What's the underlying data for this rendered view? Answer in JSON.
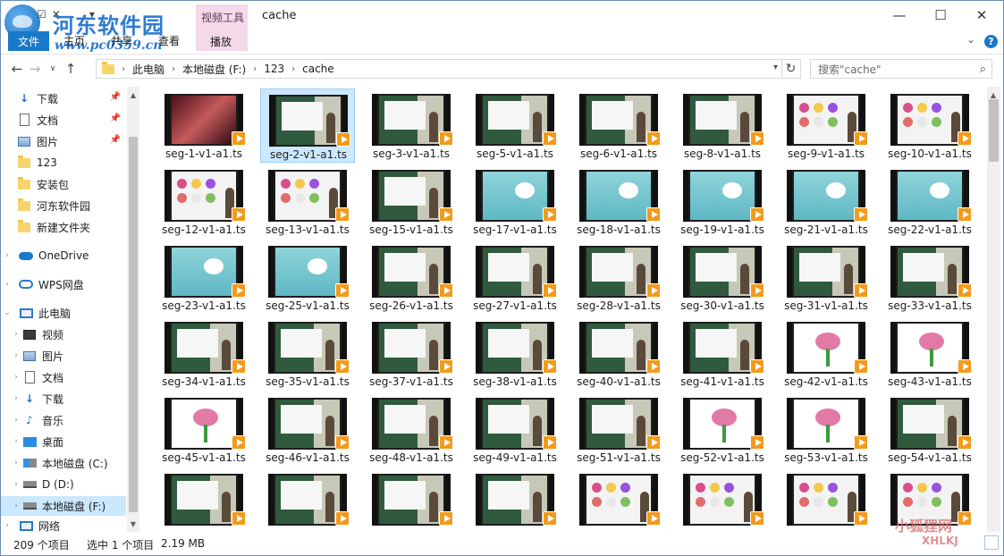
{
  "window": {
    "title": "cache",
    "brand_name": "河东软件园",
    "brand_url": "www.pc0359.cn"
  },
  "ribbon": {
    "file_tab": "文件",
    "tabs": [
      "主页",
      "共享",
      "查看"
    ],
    "context_group": "视频工具",
    "context_tab": "播放"
  },
  "address": {
    "crumbs": [
      "此电脑",
      "本地磁盘 (F:)",
      "123",
      "cache"
    ],
    "search_placeholder": "搜索\"cache\""
  },
  "sidebar": {
    "items": [
      {
        "label": "下载",
        "icon": "download-icon",
        "pinned": true
      },
      {
        "label": "文档",
        "icon": "document-icon",
        "pinned": true
      },
      {
        "label": "图片",
        "icon": "picture-icon",
        "pinned": true
      },
      {
        "label": "123",
        "icon": "folder-icon",
        "pinned": false
      },
      {
        "label": "安装包",
        "icon": "folder-icon",
        "pinned": false
      },
      {
        "label": "河东软件园",
        "icon": "folder-icon",
        "pinned": false
      },
      {
        "label": "新建文件夹",
        "icon": "folder-icon",
        "pinned": false
      },
      {
        "label": "OneDrive",
        "icon": "onedrive-icon",
        "pinned": false
      },
      {
        "label": "WPS网盘",
        "icon": "wps-cloud-icon",
        "pinned": false
      },
      {
        "label": "此电脑",
        "icon": "this-pc-icon",
        "pinned": false
      },
      {
        "label": "视频",
        "icon": "video-icon",
        "pinned": false
      },
      {
        "label": "图片",
        "icon": "picture-icon",
        "pinned": false
      },
      {
        "label": "文档",
        "icon": "document-icon",
        "pinned": false
      },
      {
        "label": "下载",
        "icon": "download-icon",
        "pinned": false
      },
      {
        "label": "音乐",
        "icon": "music-icon",
        "pinned": false
      },
      {
        "label": "桌面",
        "icon": "desktop-icon",
        "pinned": false
      },
      {
        "label": "本地磁盘 (C:)",
        "icon": "drive-c-icon",
        "pinned": false
      },
      {
        "label": "D (D:)",
        "icon": "drive-icon",
        "pinned": false
      },
      {
        "label": "本地磁盘 (F:)",
        "icon": "drive-icon",
        "pinned": false
      },
      {
        "label": "网络",
        "icon": "network-icon",
        "pinned": false
      }
    ]
  },
  "files": [
    {
      "name": "seg-1-v1-a1.ts",
      "thumb": "dark"
    },
    {
      "name": "seg-2-v1-a1.ts",
      "thumb": "classroom",
      "selected": true
    },
    {
      "name": "seg-3-v1-a1.ts",
      "thumb": "classroom"
    },
    {
      "name": "seg-5-v1-a1.ts",
      "thumb": "classroom"
    },
    {
      "name": "seg-6-v1-a1.ts",
      "thumb": "classroom"
    },
    {
      "name": "seg-8-v1-a1.ts",
      "thumb": "classroom"
    },
    {
      "name": "seg-9-v1-a1.ts",
      "thumb": "multi"
    },
    {
      "name": "seg-10-v1-a1.ts",
      "thumb": "multi"
    },
    {
      "name": "seg-12-v1-a1.ts",
      "thumb": "multi"
    },
    {
      "name": "seg-13-v1-a1.ts",
      "thumb": "multi"
    },
    {
      "name": "seg-15-v1-a1.ts",
      "thumb": "classroom"
    },
    {
      "name": "seg-17-v1-a1.ts",
      "thumb": "flowerblue"
    },
    {
      "name": "seg-18-v1-a1.ts",
      "thumb": "flowerblue"
    },
    {
      "name": "seg-19-v1-a1.ts",
      "thumb": "flowerblue"
    },
    {
      "name": "seg-21-v1-a1.ts",
      "thumb": "flowerblue"
    },
    {
      "name": "seg-22-v1-a1.ts",
      "thumb": "flowerblue"
    },
    {
      "name": "seg-23-v1-a1.ts",
      "thumb": "flowerblue"
    },
    {
      "name": "seg-25-v1-a1.ts",
      "thumb": "flowerblue"
    },
    {
      "name": "seg-26-v1-a1.ts",
      "thumb": "classroom"
    },
    {
      "name": "seg-27-v1-a1.ts",
      "thumb": "classroom"
    },
    {
      "name": "seg-28-v1-a1.ts",
      "thumb": "classroom"
    },
    {
      "name": "seg-30-v1-a1.ts",
      "thumb": "classroom"
    },
    {
      "name": "seg-31-v1-a1.ts",
      "thumb": "classroom"
    },
    {
      "name": "seg-33-v1-a1.ts",
      "thumb": "classroom"
    },
    {
      "name": "seg-34-v1-a1.ts",
      "thumb": "classroom"
    },
    {
      "name": "seg-35-v1-a1.ts",
      "thumb": "classroom"
    },
    {
      "name": "seg-37-v1-a1.ts",
      "thumb": "classroom"
    },
    {
      "name": "seg-38-v1-a1.ts",
      "thumb": "classroom"
    },
    {
      "name": "seg-40-v1-a1.ts",
      "thumb": "classroom"
    },
    {
      "name": "seg-41-v1-a1.ts",
      "thumb": "classroom"
    },
    {
      "name": "seg-42-v1-a1.ts",
      "thumb": "pinkslide"
    },
    {
      "name": "seg-43-v1-a1.ts",
      "thumb": "pinkslide"
    },
    {
      "name": "seg-45-v1-a1.ts",
      "thumb": "pinkslide"
    },
    {
      "name": "seg-46-v1-a1.ts",
      "thumb": "classroom"
    },
    {
      "name": "seg-48-v1-a1.ts",
      "thumb": "classroom"
    },
    {
      "name": "seg-49-v1-a1.ts",
      "thumb": "classroom"
    },
    {
      "name": "seg-51-v1-a1.ts",
      "thumb": "classroom"
    },
    {
      "name": "seg-52-v1-a1.ts",
      "thumb": "pinkslide"
    },
    {
      "name": "seg-53-v1-a1.ts",
      "thumb": "pinkslide"
    },
    {
      "name": "seg-54-v1-a1.ts",
      "thumb": "classroom"
    },
    {
      "name": "",
      "thumb": "classroom"
    },
    {
      "name": "",
      "thumb": "classroom"
    },
    {
      "name": "",
      "thumb": "classroom"
    },
    {
      "name": "",
      "thumb": "classroom"
    },
    {
      "name": "",
      "thumb": "multi"
    },
    {
      "name": "",
      "thumb": "multi"
    },
    {
      "name": "",
      "thumb": "multi"
    },
    {
      "name": "",
      "thumb": "multi"
    }
  ],
  "status": {
    "item_count": "209 个项目",
    "selection": "选中 1 个项目",
    "size": "2.19 MB"
  },
  "watermark": {
    "text": "小狐狸网",
    "sub": "XHLKJ"
  },
  "colors": {
    "accent": "#1979ca",
    "selection": "#cce8ff",
    "context_tab": "#f4d9e9",
    "play_badge": "#f39a1b"
  }
}
